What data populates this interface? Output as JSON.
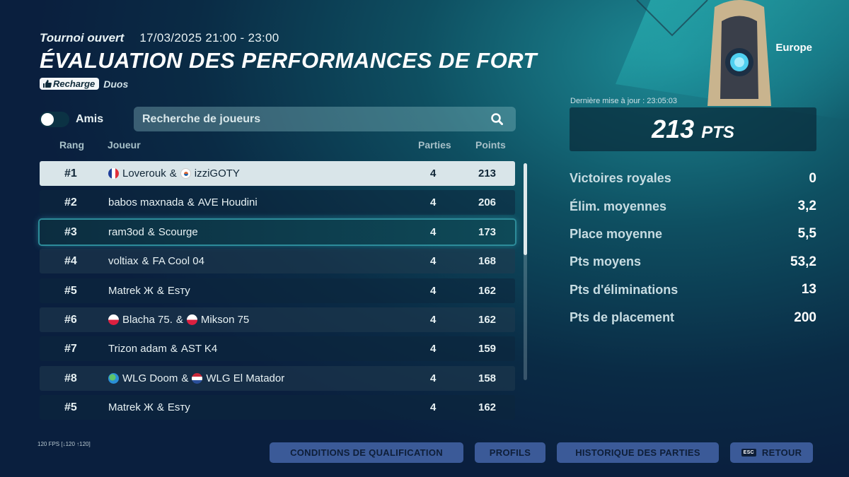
{
  "header": {
    "mode": "Tournoi ouvert",
    "datetime": "17/03/2025 21:00 - 23:00",
    "title": "ÉVALUATION DES PERFORMANCES DE FORT",
    "tag_badge": "Recharge",
    "tag_text": "Duos",
    "region": "Europe"
  },
  "filters": {
    "toggle_label": "Amis",
    "toggle_on": false,
    "search_placeholder": "Recherche de joueurs"
  },
  "columns": {
    "rank": "Rang",
    "player": "Joueur",
    "games": "Parties",
    "points": "Points"
  },
  "rows": [
    {
      "rank": "#1",
      "p1": "Loverouk",
      "f1": "fr",
      "sep": "&",
      "p2": "izziGOTY",
      "f2": "kr",
      "games": "4",
      "points": "213"
    },
    {
      "rank": "#2",
      "p1": "babos maxnada",
      "f1": "",
      "sep": "&",
      "p2": "AVE Houdini",
      "f2": "",
      "games": "4",
      "points": "206"
    },
    {
      "rank": "#3",
      "p1": "ram3od",
      "f1": "",
      "sep": "&",
      "p2": "Scourge",
      "f2": "",
      "games": "4",
      "points": "173"
    },
    {
      "rank": "#4",
      "p1": "voltiax",
      "f1": "",
      "sep": "&",
      "p2": "FA Cool 04",
      "f2": "",
      "games": "4",
      "points": "168"
    },
    {
      "rank": "#5",
      "p1": "Matrek Ж",
      "f1": "",
      "sep": "&",
      "p2": "Esтy",
      "f2": "",
      "games": "4",
      "points": "162"
    },
    {
      "rank": "#6",
      "p1": "Blacha 75.",
      "f1": "pl",
      "sep": "&",
      "p2": "Mikson 75",
      "f2": "pl",
      "games": "4",
      "points": "162"
    },
    {
      "rank": "#7",
      "p1": "Trizon adam",
      "f1": "",
      "sep": "&",
      "p2": "AST K4",
      "f2": "",
      "games": "4",
      "points": "159"
    },
    {
      "rank": "#8",
      "p1": "WLG Doom",
      "f1": "world",
      "sep": "&",
      "p2": "WLG El Matador",
      "f2": "nl",
      "games": "4",
      "points": "158"
    },
    {
      "rank": "#5",
      "p1": "Matrek Ж",
      "f1": "",
      "sep": "&",
      "p2": "Esтy",
      "f2": "",
      "games": "4",
      "points": "162"
    }
  ],
  "summary": {
    "updated": "Dernière mise à jour : 23:05:03",
    "score_value": "213",
    "score_unit": "PTS"
  },
  "stats": [
    {
      "label": "Victoires royales",
      "value": "0"
    },
    {
      "label": "Élim. moyennes",
      "value": "3,2"
    },
    {
      "label": "Place moyenne",
      "value": "5,5"
    },
    {
      "label": "Pts moyens",
      "value": "53,2"
    },
    {
      "label": "Pts d'éliminations",
      "value": "13"
    },
    {
      "label": "Pts de placement",
      "value": "200"
    }
  ],
  "footer": {
    "fps": "120 FPS [↓120 ↑120]",
    "btn_conditions": "CONDITIONS DE QUALIFICATION",
    "btn_profils": "PROFILS",
    "btn_historique": "HISTORIQUE DES PARTIES",
    "esc_key": "ESC",
    "btn_retour": "RETOUR"
  },
  "colors": {
    "button_bg": "#3b5a98",
    "selected_row": "#d9e5e9",
    "focus_glow": "#2d8c9a"
  }
}
